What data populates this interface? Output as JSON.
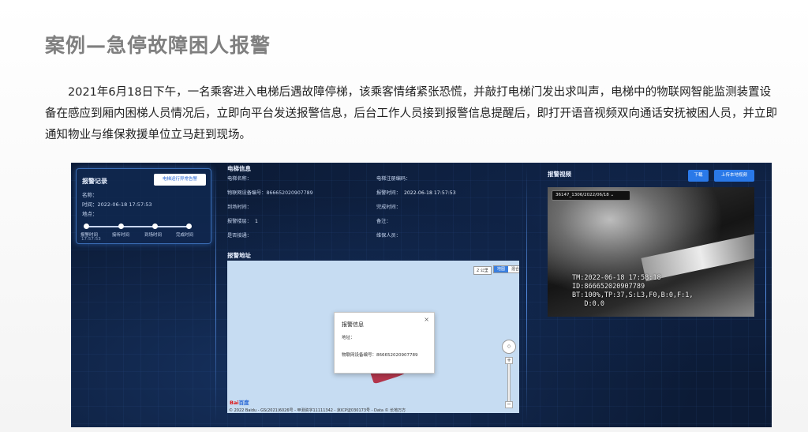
{
  "slide": {
    "title": "案例—急停故障困人报警",
    "paragraph": "2021年6月18日下午，一名乘客进入电梯后遇故障停梯，该乘客情绪紧张恐慌，并敲打电梯门发出求叫声，电梯中的物联网智能监测装置设备在感应到厢内困梯人员情况后，立即向平台发送报警信息，后台工作人员接到报警信息提醒后，即打开语音视频双向通话安抚被困人员，并立即通知物业与维保救援单位立马赶到现场。"
  },
  "alarm_record": {
    "title": "报警记录",
    "button": "电梯运行异常告警",
    "name_label": "名称：",
    "time_label": "时间：",
    "time_value": "2022-06-18 17:57:53",
    "location_label": "地点：",
    "timeline": [
      "报警时间",
      "接听时间",
      "到场时间",
      "完成时间"
    ],
    "timeline_time": "17:57:53"
  },
  "elevator_info": {
    "title": "电梯信息",
    "fields_left": [
      {
        "label": "电梯名称：",
        "value": ""
      },
      {
        "label": "物联网设备编号：",
        "value": "866652020907789"
      },
      {
        "label": "到场时间：",
        "value": ""
      },
      {
        "label": "报警楼层：",
        "value": "1"
      },
      {
        "label": "是否接通：",
        "value": ""
      }
    ],
    "fields_right": [
      {
        "label": "电梯注册编码：",
        "value": ""
      },
      {
        "label": "报警时间：",
        "value": "2022-06-18 17:57:53"
      },
      {
        "label": "完成时间：",
        "value": ""
      },
      {
        "label": "备注：",
        "value": ""
      },
      {
        "label": "维保人员：",
        "value": ""
      }
    ]
  },
  "alarm_map": {
    "title": "报警地址",
    "scale": "2 公里",
    "map_types": [
      "地图",
      "混合"
    ],
    "popup": {
      "title": "报警信息",
      "close": "×",
      "address_label": "地址：",
      "device_label": "物联网设备编号：",
      "device_value": "866652020907789"
    },
    "zoom_in": "+",
    "zoom_out": "−",
    "pan": "◇",
    "logo": "Bai",
    "logo_tail": "百度",
    "copyright": "© 2022 Baidu - GS(2021)6026号 - 甲测资字11111342 - 京ICP证030173号 - Data © 长地万方"
  },
  "alarm_video": {
    "title": "报警视频",
    "download": "下载",
    "upload": "上传本地视频",
    "select": "36147_1306/2022/06/18",
    "osd": "TM:2022-06-18 17:58:18\nID:866652020907789\nBT:100%,TP:37,S:L3,F0,B:0,F:1,\n   D:0.0"
  }
}
